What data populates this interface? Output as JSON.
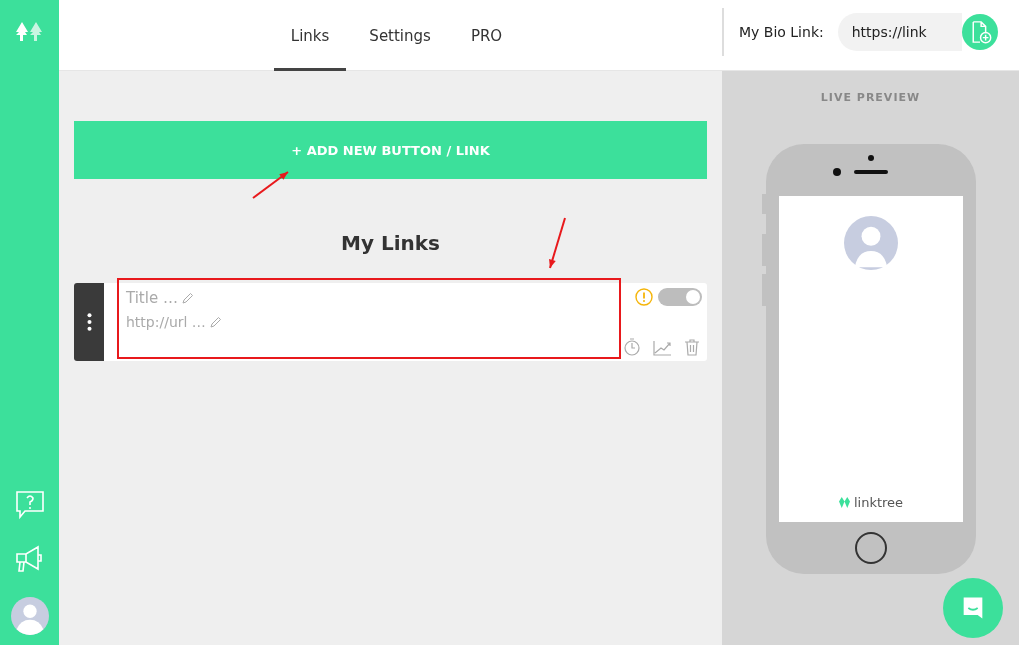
{
  "tabs": [
    {
      "label": "Links",
      "selected": true
    },
    {
      "label": "Settings",
      "selected": false
    },
    {
      "label": "PRO",
      "selected": false
    }
  ],
  "bio_link": {
    "label": "My Bio Link:",
    "value": "https://link"
  },
  "add_button": {
    "label": "+ ADD NEW BUTTON / LINK"
  },
  "section_title": "My Links",
  "links": [
    {
      "title_placeholder": "Title …",
      "url_placeholder": "http://url …",
      "on": true,
      "disabled": true,
      "warning": true
    }
  ],
  "preview": {
    "label": "LIVE PREVIEW",
    "brand": "linktree"
  },
  "annotations": [
    {
      "kind": "arrow"
    },
    {
      "kind": "arrow"
    },
    {
      "kind": "box"
    }
  ]
}
